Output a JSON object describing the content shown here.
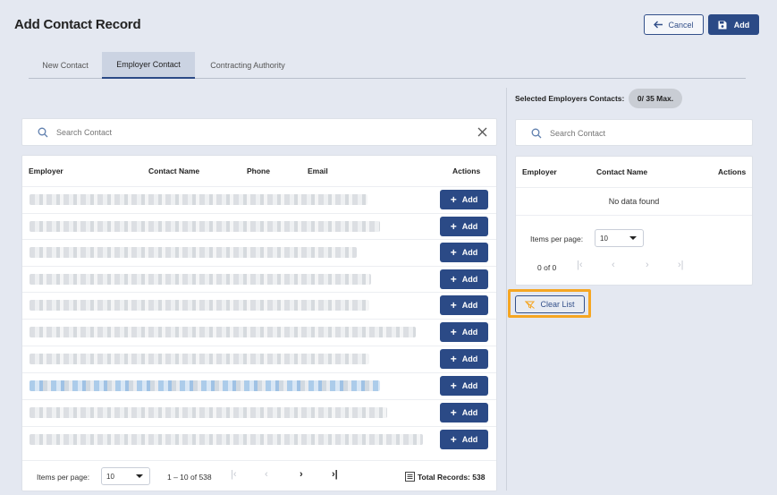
{
  "header": {
    "title": "Add Contact Record",
    "cancel_label": "Cancel",
    "add_label": "Add"
  },
  "tabs": [
    {
      "label": "New Contact",
      "active": false
    },
    {
      "label": "Employer Contact",
      "active": true
    },
    {
      "label": "Contracting Authority",
      "active": false
    }
  ],
  "left": {
    "search_placeholder": "Search Contact",
    "columns": [
      "Employer",
      "Contact Name",
      "Phone",
      "Email",
      "Actions"
    ],
    "row_action_label": "Add",
    "footer": {
      "items_per_page_label": "Items per page:",
      "items_per_page_value": "10",
      "range": "1 – 10 of 538",
      "total_records": "Total Records: 538"
    }
  },
  "right": {
    "selected_label": "Selected Employers Contacts:",
    "badge": "0/ 35 Max.",
    "search_placeholder": "Search Contact",
    "columns": [
      "Employer",
      "Contact Name",
      "Actions"
    ],
    "empty_text": "No data found",
    "items_per_page_label": "Items per page:",
    "items_per_page_value": "10",
    "range": "0 of 0",
    "clear_label": "Clear List"
  },
  "colors": {
    "primary": "#2b4a86",
    "highlight": "#f5a623",
    "background": "#e4e8f1"
  }
}
